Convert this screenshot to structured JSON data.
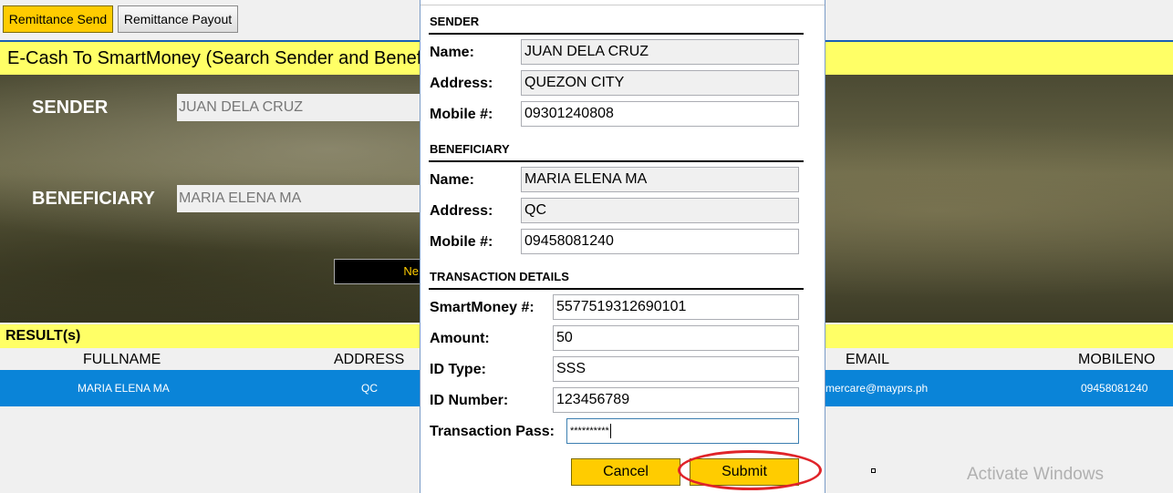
{
  "tabs": {
    "send": "Remittance Send",
    "payout": "Remittance Payout"
  },
  "page_title": "E-Cash To SmartMoney (Search Sender and Benef",
  "search": {
    "sender_label": "SENDER",
    "sender_value": "JUAN DELA CRUZ",
    "beneficiary_label": "BENEFICIARY",
    "beneficiary_value": "MARIA ELENA MA",
    "new_button": "Ne"
  },
  "results": {
    "title": "RESULT(s)",
    "columns": {
      "fullname": "FULLNAME",
      "address": "ADDRESS",
      "email": "EMAIL",
      "mobileno": "MOBILENO"
    },
    "row": {
      "fullname": "MARIA ELENA MA",
      "address": "QC",
      "email": "mercare@mayprs.ph",
      "mobileno": "09458081240"
    }
  },
  "modal": {
    "sender_section": "SENDER",
    "sender": {
      "name_label": "Name:",
      "name": "JUAN DELA CRUZ",
      "address_label": "Address:",
      "address": "QUEZON CITY",
      "mobile_label": "Mobile #:",
      "mobile": "09301240808"
    },
    "beneficiary_section": "BENEFICIARY",
    "beneficiary": {
      "name_label": "Name:",
      "name": "MARIA ELENA MA",
      "address_label": "Address:",
      "address": "QC",
      "mobile_label": "Mobile #:",
      "mobile": "09458081240"
    },
    "transaction_section": "TRANSACTION DETAILS",
    "transaction": {
      "smartmoney_label": "SmartMoney #:",
      "smartmoney": "5577519312690101",
      "amount_label": "Amount:",
      "amount": "50",
      "idtype_label": "ID Type:",
      "idtype": "SSS",
      "idnumber_label": "ID Number:",
      "idnumber": "123456789",
      "pass_label": "Transaction Pass:",
      "pass": "**********"
    },
    "cancel": "Cancel",
    "submit": "Submit"
  },
  "watermark": "Activate Windows",
  "colors": {
    "accent_yellow": "#ffff66",
    "button_yellow": "#ffcc00",
    "selected_row": "#0a84d8",
    "highlight": "#e0242a"
  }
}
